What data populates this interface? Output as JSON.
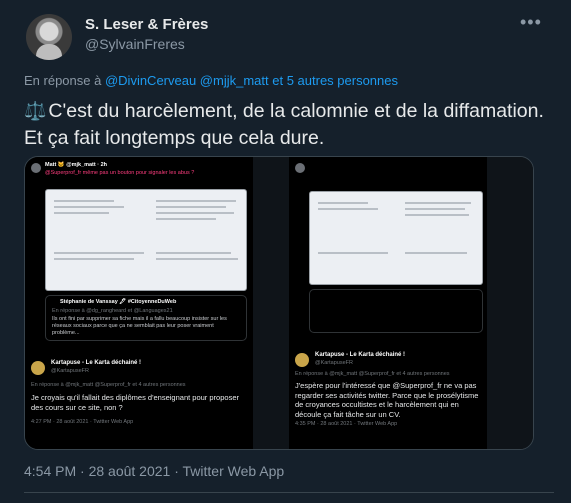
{
  "author": {
    "name": "S. Leser & Frères",
    "handle": "@SylvainFreres"
  },
  "reply_to": {
    "prefix": "En réponse à",
    "users": "@DivinCerveau @mjjk_matt",
    "others": "et 5 autres personnes"
  },
  "tweet": {
    "emoji": "⚖️",
    "text": "C'est du harcèlement, de la calomnie et de la diffamation. Et ça fait longtemps que cela dure."
  },
  "meta": {
    "timestamp": "4:54 PM · 28 août 2021 · Twitter Web App"
  },
  "icons": {
    "more": "more-options-icon",
    "scales": "balance-scale-icon"
  },
  "media": {
    "left": {
      "author_line": "Matt 🐱 @mjk_matt · 2h",
      "pink_line": "@Superprof_fr même pas un bouton pour signaler les abus ?",
      "quote_author": "Stéphanie de Vanssay 🖋 #CitoyenneDuWeb",
      "quote_reply": "En réponse à @dg_rangheard et @Languages21",
      "quote_text": "Ils ont fini par supprimer sa fiche mais il a fallu beaucoup insister sur les réseaux sociaux parce que ça ne semblait pas leur poser vraiment problème...",
      "main_author": "Kartapuse - Le Karta déchainé !",
      "main_handle": "@KartapuseFR",
      "main_reply": "En réponse à @mjk_matt @Superprof_fr et 4 autres personnes",
      "main_text": "Je croyais qu'il fallait des diplômes d'enseignant pour proposer des cours sur ce site, non ?",
      "main_time": "4:27 PM · 28 août 2021 · Twitter Web App"
    },
    "right": {
      "main_author": "Kartapuse - Le Karta déchainé !",
      "main_handle": "@KartapuseFR",
      "main_reply": "En réponse à @mjk_matt @Superprof_fr et 4 autres personnes",
      "main_text": "J'espère pour l'intéressé que @Superprof_fr ne va pas regarder ses activités twitter. Parce que le prosélytisme de croyances occultistes et le harcèlement qui en découle ça fait tâche sur un CV.",
      "main_time": "4:35 PM · 28 août 2021 · Twitter Web App"
    }
  }
}
